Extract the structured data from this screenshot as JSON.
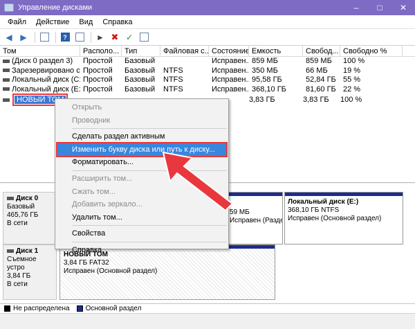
{
  "window": {
    "title": "Управление дисками"
  },
  "menubar": [
    "Файл",
    "Действие",
    "Вид",
    "Справка"
  ],
  "columns": [
    "Том",
    "Располо...",
    "Тип",
    "Файловая с...",
    "Состояние",
    "Емкость",
    "Свобод...",
    "Свободно %"
  ],
  "volumes": [
    {
      "name": "(Диск 0 раздел 3)",
      "layout": "Простой",
      "type": "Базовый",
      "fs": "",
      "state": "Исправен...",
      "capacity": "859 МБ",
      "free": "859 МБ",
      "free_pct": "100 %"
    },
    {
      "name": "Зарезервировано с...",
      "layout": "Простой",
      "type": "Базовый",
      "fs": "NTFS",
      "state": "Исправен...",
      "capacity": "350 МБ",
      "free": "66 МБ",
      "free_pct": "19 %"
    },
    {
      "name": "Локальный диск (C:)",
      "layout": "Простой",
      "type": "Базовый",
      "fs": "NTFS",
      "state": "Исправен...",
      "capacity": "95,58 ГБ",
      "free": "52,84 ГБ",
      "free_pct": "55 %"
    },
    {
      "name": "Локальный диск (E:)",
      "layout": "Простой",
      "type": "Базовый",
      "fs": "NTFS",
      "state": "Исправен...",
      "capacity": "368,10 ГБ",
      "free": "81,60 ГБ",
      "free_pct": "22 %"
    }
  ],
  "selected_volume": {
    "name": "НОВЫЙ ТОМ",
    "capacity": "3,83 ГБ",
    "free": "3,83 ГБ",
    "free_pct": "100 %"
  },
  "context_menu": {
    "open": "Открыть",
    "explorer": "Проводник",
    "mark_active": "Сделать раздел активным",
    "change_letter": "Изменить букву диска или путь к диску...",
    "format": "Форматировать...",
    "extend": "Расширить том...",
    "shrink": "Сжать том...",
    "add_mirror": "Добавить зеркало...",
    "delete": "Удалить том...",
    "properties": "Свойства",
    "help": "Справка"
  },
  "disk0": {
    "name": "Диск 0",
    "type": "Базовый",
    "size": "465,76 ГБ",
    "status": "В сети",
    "p1_size": "59 МБ",
    "p1_status": "Исправен (Раздел",
    "p2_name": "Локальный диск  (E:)",
    "p2_size": "368,10 ГБ NTFS",
    "p2_status": "Исправен (Основной раздел)"
  },
  "disk1": {
    "name": "Диск 1",
    "type": "Съемное устро",
    "size": "3,84 ГБ",
    "status": "В сети",
    "p_name": "НОВЫЙ ТОМ",
    "p_size": "3,84 ГБ FAT32",
    "p_status": "Исправен (Основной раздел)"
  },
  "legend": {
    "unallocated": "Не распределена",
    "primary": "Основной раздел"
  },
  "colors": {
    "titlebar": "#7d6bc4",
    "primary": "#1e2b8a",
    "highlight": "#3a86dd",
    "callout": "#e8383d"
  }
}
